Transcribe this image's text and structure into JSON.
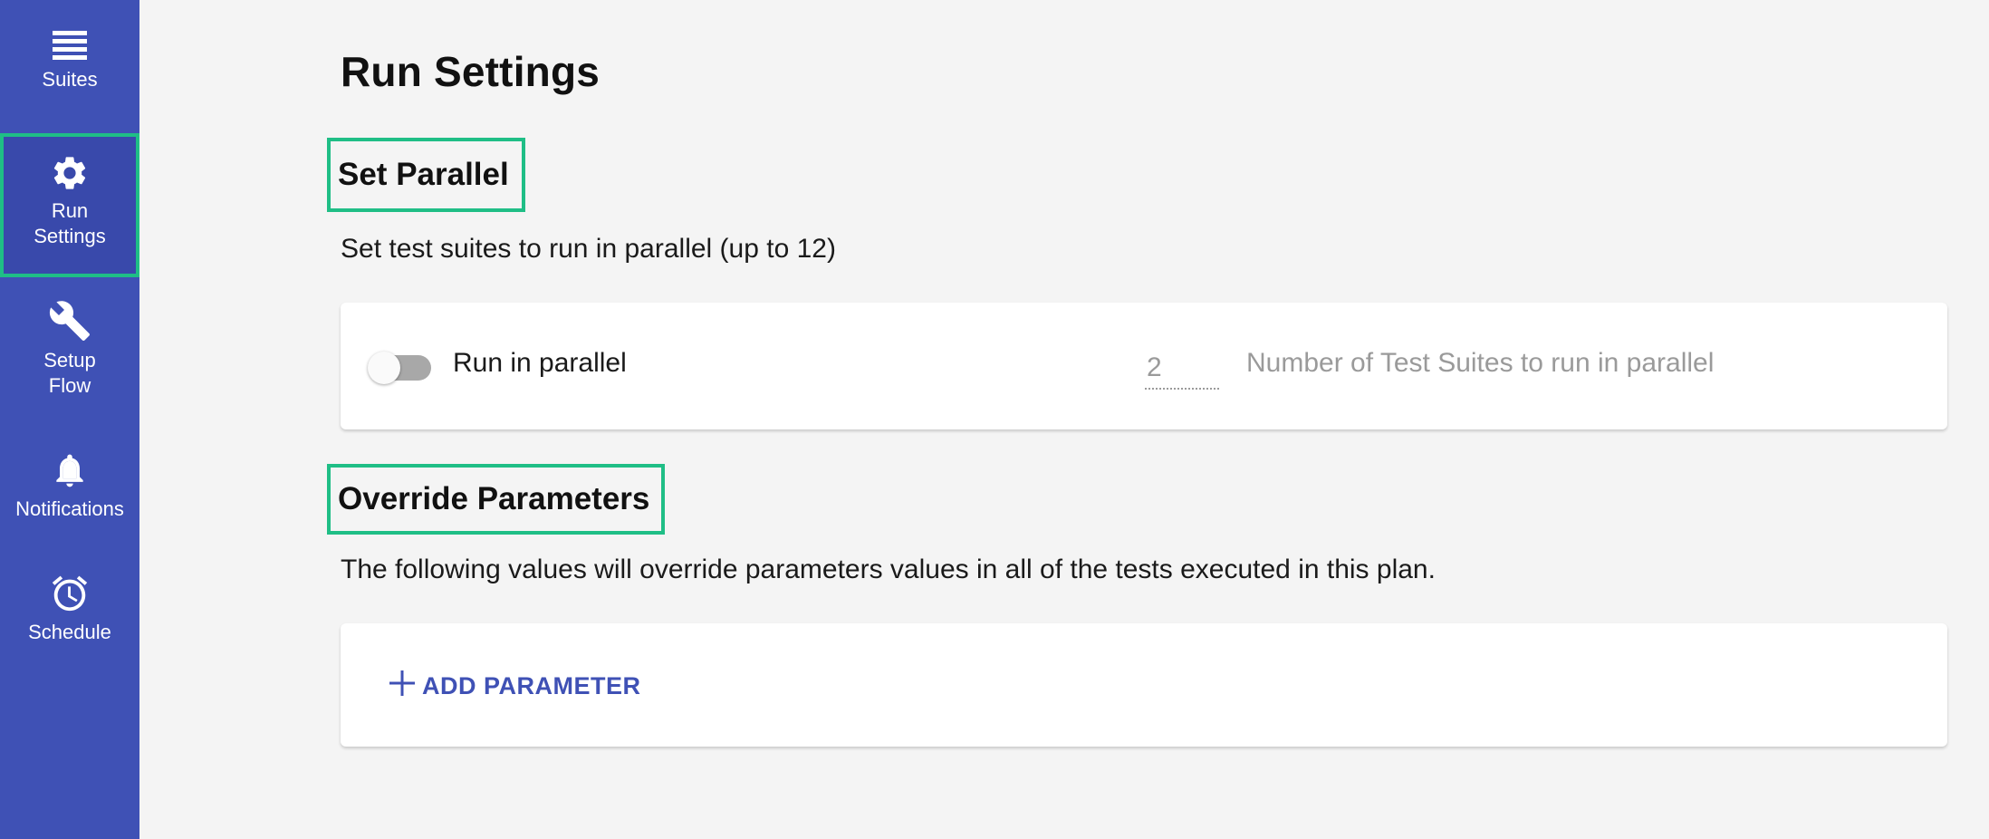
{
  "sidebar": {
    "items": [
      {
        "label": "Suites",
        "icon": "list-icon"
      },
      {
        "label": "Run\nSettings",
        "icon": "gear-icon",
        "active": true
      },
      {
        "label": "Setup\nFlow",
        "icon": "wrench-icon"
      },
      {
        "label": "Notifications",
        "icon": "bell-icon"
      },
      {
        "label": "Schedule",
        "icon": "alarm-clock-icon"
      }
    ]
  },
  "main": {
    "title": "Run Settings",
    "parallel": {
      "title": "Set Parallel",
      "description": "Set test suites to run in parallel (up to 12)",
      "toggle_label": "Run in parallel",
      "toggle_on": false,
      "count_value": "2",
      "count_helper": "Number of Test Suites to run in parallel"
    },
    "override": {
      "title": "Override Parameters",
      "description": "The following values will override parameters values in all of the tests executed in this plan.",
      "add_label": "ADD PARAMETER"
    }
  },
  "colors": {
    "sidebar_bg": "#3f51b5",
    "highlight": "#1fbe86",
    "accent": "#3f51b5",
    "page_bg": "#f4f4f4"
  }
}
